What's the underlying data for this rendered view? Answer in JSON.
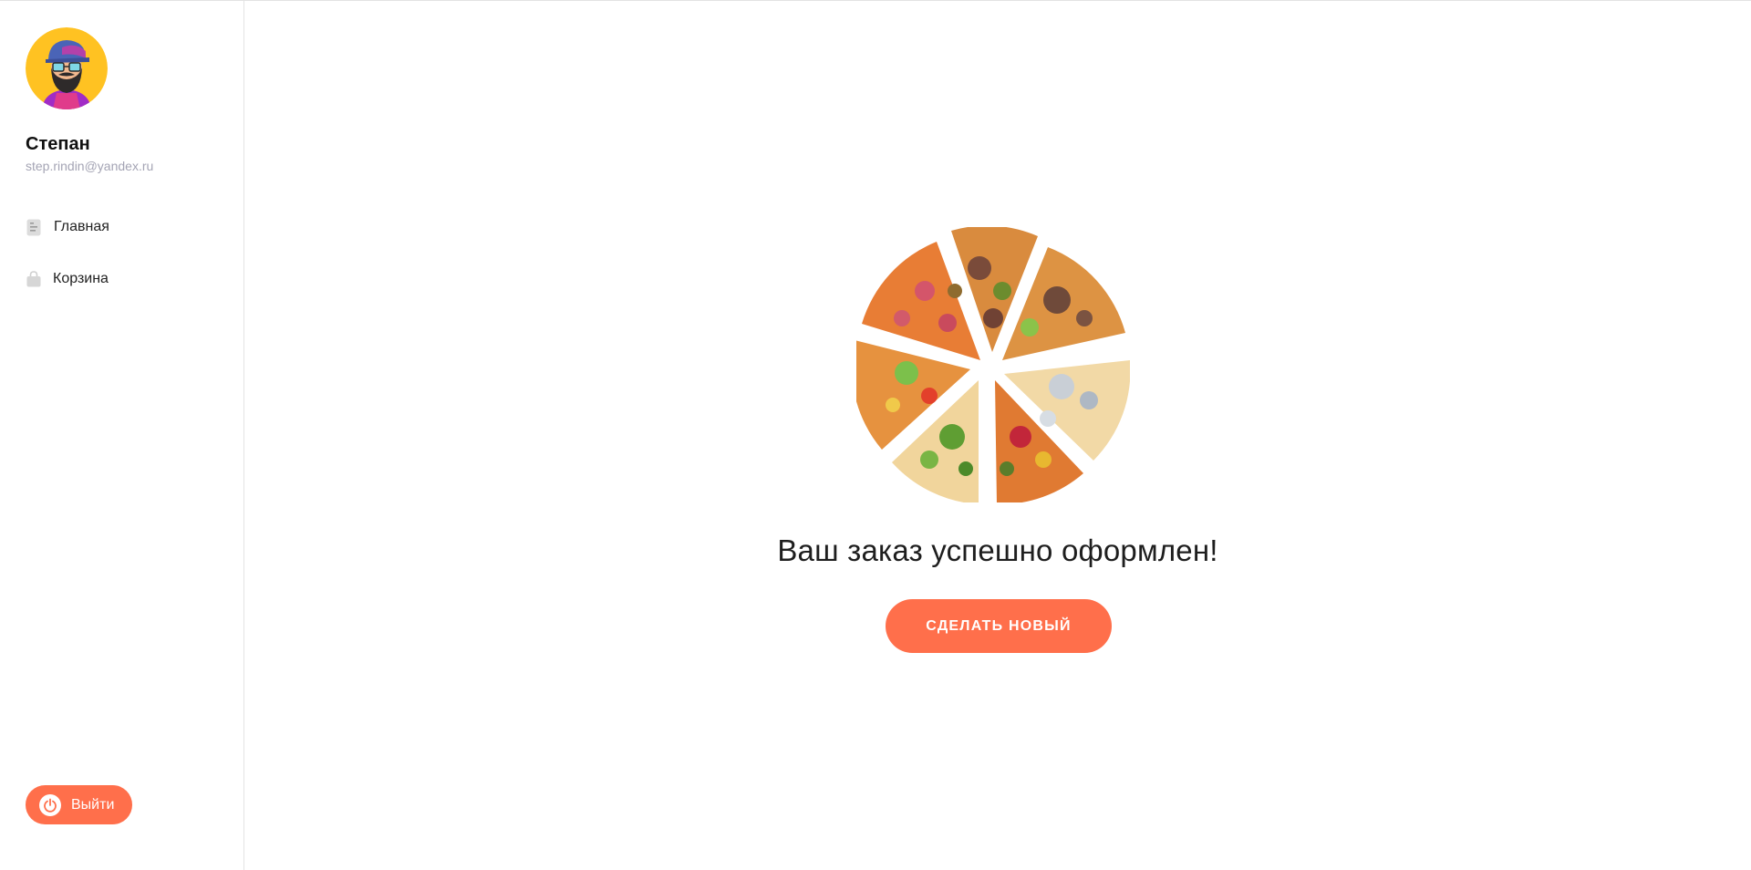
{
  "user": {
    "name": "Степан",
    "email": "step.rindin@yandex.ru",
    "avatar_icon": "bearded-man-avatar"
  },
  "sidebar": {
    "items": [
      {
        "label": "Главная",
        "icon": "document-list-icon"
      },
      {
        "label": "Корзина",
        "icon": "shopping-bag-icon"
      }
    ],
    "logout_label": "Выйти",
    "logout_icon": "power-icon"
  },
  "main": {
    "image": "pizza-slices",
    "success_message": "Ваш заказ успешно оформлен!",
    "new_order_label": "СДЕЛАТЬ НОВЫЙ"
  },
  "colors": {
    "accent": "#ff6f4b",
    "avatar_background": "#ffc222",
    "email_text": "#a4a4b4"
  }
}
